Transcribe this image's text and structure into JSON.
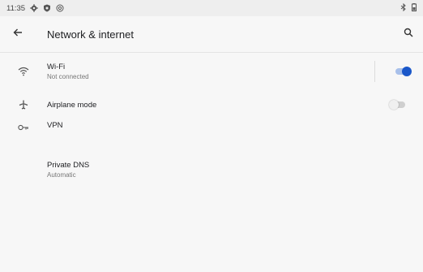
{
  "status_bar": {
    "time": "11:35",
    "icons_left": [
      "gear-icon",
      "shield-icon",
      "at-sign-icon"
    ],
    "icons_right": [
      "bluetooth-icon",
      "battery-icon"
    ]
  },
  "header": {
    "title": "Network & internet",
    "back_icon": "arrow-left-icon",
    "search_icon": "search-icon"
  },
  "settings": {
    "wifi": {
      "title": "Wi-Fi",
      "subtitle": "Not connected",
      "enabled": true,
      "icon": "wifi-icon"
    },
    "airplane": {
      "title": "Airplane mode",
      "enabled": false,
      "icon": "airplane-icon"
    },
    "vpn": {
      "title": "VPN",
      "icon": "key-icon"
    },
    "private_dns": {
      "title": "Private DNS",
      "subtitle": "Automatic"
    }
  },
  "colors": {
    "accent": "#1a57c9",
    "accent_track": "#a8c0ea",
    "off_track": "#cfcfcf",
    "off_thumb": "#f0f0f0",
    "background": "#f7f7f7",
    "status_bar": "#eeeeee"
  }
}
